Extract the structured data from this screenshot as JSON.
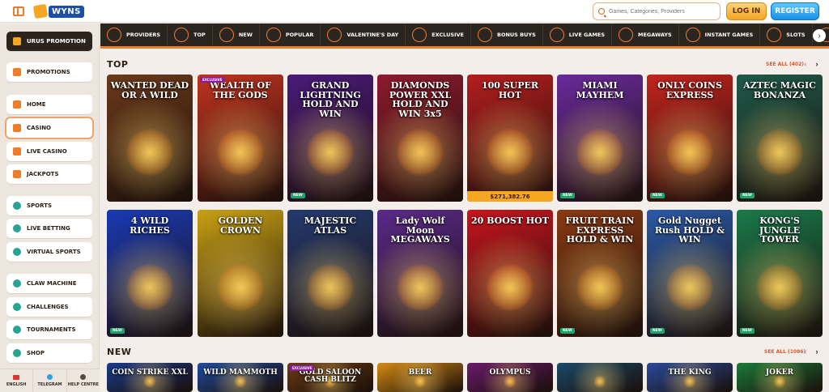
{
  "header": {
    "logo_text": "WYNS",
    "search_placeholder": "Games, Categories, Providers",
    "login_label": "LOG IN",
    "register_label": "REGISTER"
  },
  "sidebar": {
    "items": [
      {
        "label": "URUS PROMOTION"
      },
      {
        "label": "PROMOTIONS"
      },
      {
        "label": "HOME"
      },
      {
        "label": "CASINO"
      },
      {
        "label": "LIVE CASINO"
      },
      {
        "label": "JACKPOTS"
      },
      {
        "label": "SPORTS"
      },
      {
        "label": "LIVE BETTING"
      },
      {
        "label": "VIRTUAL SPORTS"
      },
      {
        "label": "CLAW MACHINE"
      },
      {
        "label": "CHALLENGES"
      },
      {
        "label": "TOURNAMENTS"
      },
      {
        "label": "SHOP"
      }
    ],
    "footer": [
      {
        "label": "ENGLISH"
      },
      {
        "label": "TELEGRAM"
      },
      {
        "label": "HELP CENTRE"
      }
    ]
  },
  "categories": [
    {
      "label": "PROVIDERS"
    },
    {
      "label": "TOP"
    },
    {
      "label": "NEW"
    },
    {
      "label": "POPULAR"
    },
    {
      "label": "VALENTINE'S DAY"
    },
    {
      "label": "EXCLUSIVE"
    },
    {
      "label": "BONUS BUYS"
    },
    {
      "label": "LIVE GAMES"
    },
    {
      "label": "MEGAWAYS"
    },
    {
      "label": "INSTANT GAMES"
    },
    {
      "label": "SLOTS"
    }
  ],
  "sections": {
    "top": {
      "title": "TOP",
      "see_all": "SEE ALL (402)"
    },
    "new": {
      "title": "NEW",
      "see_all": "SEE ALL (1086)"
    }
  },
  "top_games": [
    {
      "name": "WANTED DEAD OR A WILD",
      "bg": "#6b3a1a"
    },
    {
      "name": "WEALTH OF THE GODS",
      "bg": "#c2331f",
      "badge": "EXCLUSIVE"
    },
    {
      "name": "GRAND LIGHTNING HOLD AND WIN",
      "bg": "#4a1a7a",
      "badge_new": "NEW"
    },
    {
      "name": "DIAMONDS POWER XXL HOLD AND WIN 3x5",
      "bg": "#8e1a2e"
    },
    {
      "name": "100 SUPER HOT",
      "bg": "#b51e1e",
      "jackpot": "$271,382.76"
    },
    {
      "name": "MIAMI MAYHEM",
      "bg": "#6a2a9c",
      "badge_new": "NEW"
    },
    {
      "name": "ONLY COINS EXPRESS",
      "bg": "#c4241e",
      "badge_new": "NEW"
    },
    {
      "name": "AZTEC MAGIC BONANZA",
      "bg": "#1f5a4a",
      "badge_new": "NEW"
    }
  ],
  "row2_games": [
    {
      "name": "4 WILD RICHES",
      "bg": "#1a3ab5",
      "badge_new": "NEW"
    },
    {
      "name": "GOLDEN CROWN",
      "bg": "#c9a114"
    },
    {
      "name": "MAJESTIC ATLAS",
      "bg": "#243a6e"
    },
    {
      "name": "Lady Wolf Moon MEGAWAYS",
      "bg": "#5a2a8a"
    },
    {
      "name": "20 BOOST HOT",
      "bg": "#c8151e"
    },
    {
      "name": "FRUIT TRAIN EXPRESS HOLD & WIN",
      "bg": "#8a3a14",
      "badge_new": "NEW"
    },
    {
      "name": "Gold Nugget Rush HOLD & WIN",
      "bg": "#2a5aa8",
      "badge_new": "NEW"
    },
    {
      "name": "KONG'S JUNGLE TOWER",
      "bg": "#1a7a4a",
      "badge_new": "NEW"
    }
  ],
  "new_games": [
    {
      "name": "COIN STRIKE XXL",
      "bg": "#1a3a8a"
    },
    {
      "name": "WILD MAMMOTH",
      "bg": "#1f4a9c"
    },
    {
      "name": "GOLD SALOON CASH BLITZ",
      "bg": "#6a3a14",
      "badge": "EXCLUSIVE"
    },
    {
      "name": "BEER",
      "bg": "#d48a14"
    },
    {
      "name": "OLYMPUS",
      "bg": "#6a1a6a"
    },
    {
      "name": "",
      "bg": "#1a4a6a"
    },
    {
      "name": "THE KING",
      "bg": "#2a4a9c"
    },
    {
      "name": "JOKER",
      "bg": "#1a7a3a"
    }
  ]
}
